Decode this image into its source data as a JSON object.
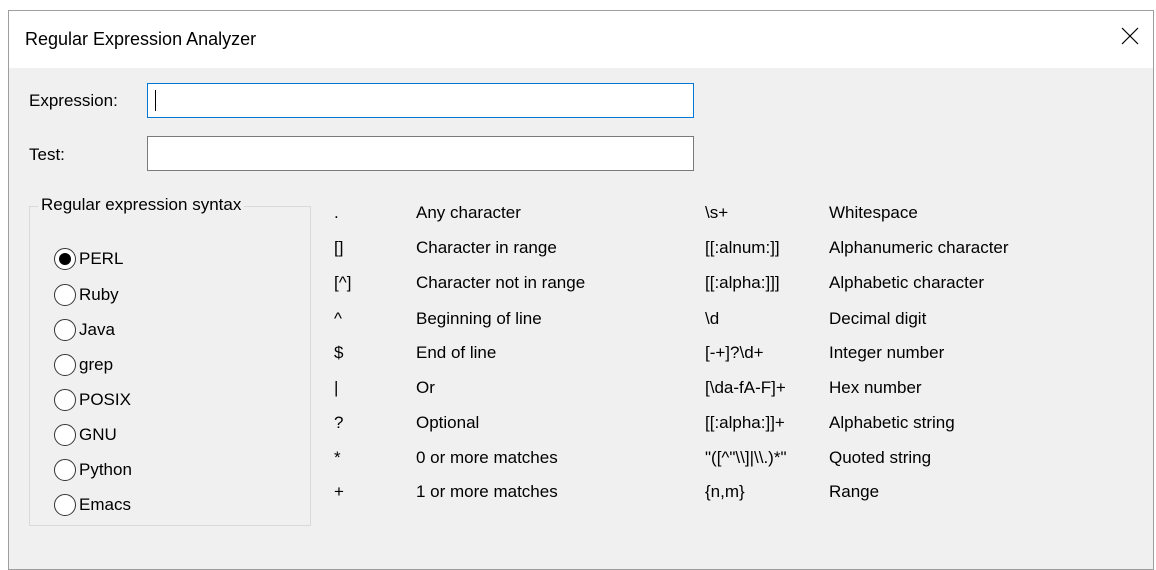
{
  "window": {
    "title": "Regular Expression Analyzer"
  },
  "form": {
    "expression_label": "Expression:",
    "expression_value": "",
    "test_label": "Test:",
    "test_value": ""
  },
  "syntax_group": {
    "title": "Regular expression syntax",
    "selected": "PERL",
    "options": [
      "PERL",
      "Ruby",
      "Java",
      "grep",
      "POSIX",
      "GNU",
      "Python",
      "Emacs"
    ]
  },
  "reference": {
    "left": [
      {
        "symbol": ".",
        "description": "Any character"
      },
      {
        "symbol": "[]",
        "description": "Character in range"
      },
      {
        "symbol": "[^]",
        "description": "Character not in range"
      },
      {
        "symbol": "^",
        "description": "Beginning of line"
      },
      {
        "symbol": "$",
        "description": "End of line"
      },
      {
        "symbol": "|",
        "description": "Or"
      },
      {
        "symbol": "?",
        "description": "Optional"
      },
      {
        "symbol": "*",
        "description": "0 or more matches"
      },
      {
        "symbol": "+",
        "description": "1 or more matches"
      }
    ],
    "right": [
      {
        "pattern": "\\s+",
        "description": "Whitespace"
      },
      {
        "pattern": "[[:alnum:]]",
        "description": "Alphanumeric character"
      },
      {
        "pattern": "[[:alpha:]]]",
        "description": "Alphabetic character"
      },
      {
        "pattern": "\\d",
        "description": "Decimal digit"
      },
      {
        "pattern": "[-+]?\\d+",
        "description": "Integer number"
      },
      {
        "pattern": "[\\da-fA-F]+",
        "description": "Hex number"
      },
      {
        "pattern": "[[:alpha:]]+",
        "description": "Alphabetic string"
      },
      {
        "pattern": "\"([^\"\\\\]|\\\\.)*\"",
        "description": "Quoted string"
      },
      {
        "pattern": "{n,m}",
        "description": "Range"
      }
    ]
  },
  "icons": {
    "close": "close-icon",
    "radio": "radio-icon"
  },
  "colors": {
    "dialog_bg": "#f0f0f0",
    "titlebar_bg": "#ffffff",
    "focus_border": "#0078d7"
  }
}
